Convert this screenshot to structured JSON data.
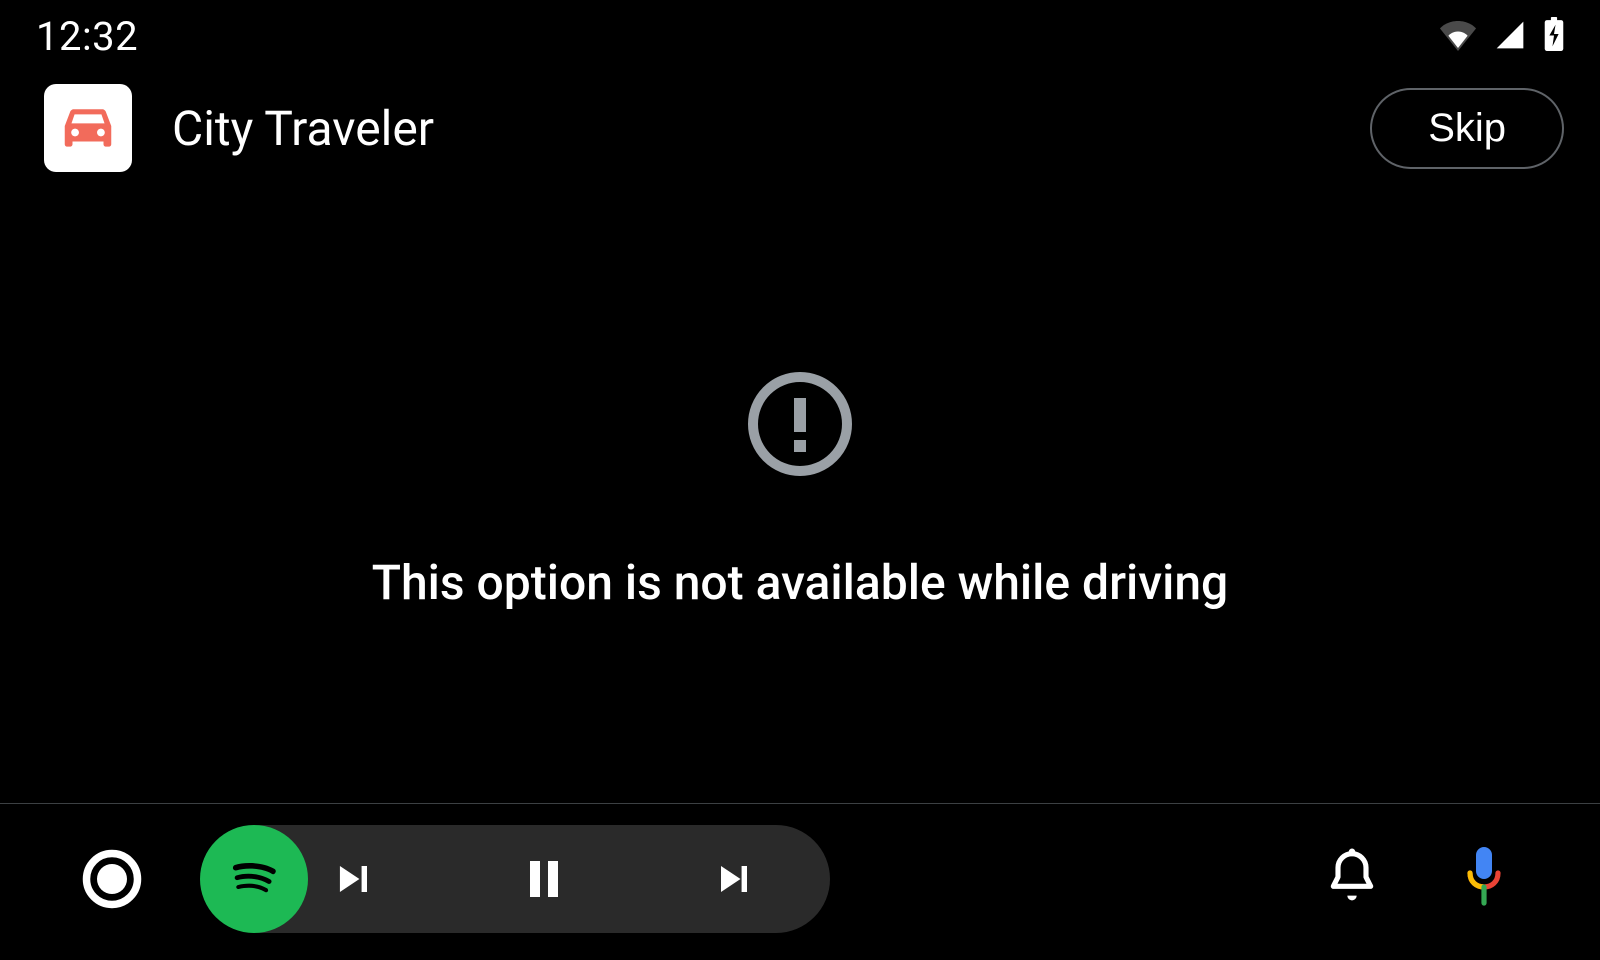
{
  "statusbar": {
    "time": "12:32"
  },
  "header": {
    "app_name": "City Traveler",
    "skip_label": "Skip"
  },
  "content": {
    "message": "This option is not available while driving"
  },
  "icons": {
    "wifi": "wifi-icon",
    "cell": "cellular-icon",
    "battery": "battery-charging-icon",
    "car": "car-icon",
    "alert": "alert-circle-icon",
    "home": "home-circle-icon",
    "spotify": "spotify-icon",
    "prev": "skip-previous-icon",
    "pause": "pause-icon",
    "next": "skip-next-icon",
    "bell": "notifications-icon",
    "mic": "mic-icon"
  },
  "colors": {
    "spotify_green": "#1db954",
    "accent_orange": "#f26b5b",
    "muted": "#9aa0a6",
    "pill_bg": "#2a2a2a"
  }
}
